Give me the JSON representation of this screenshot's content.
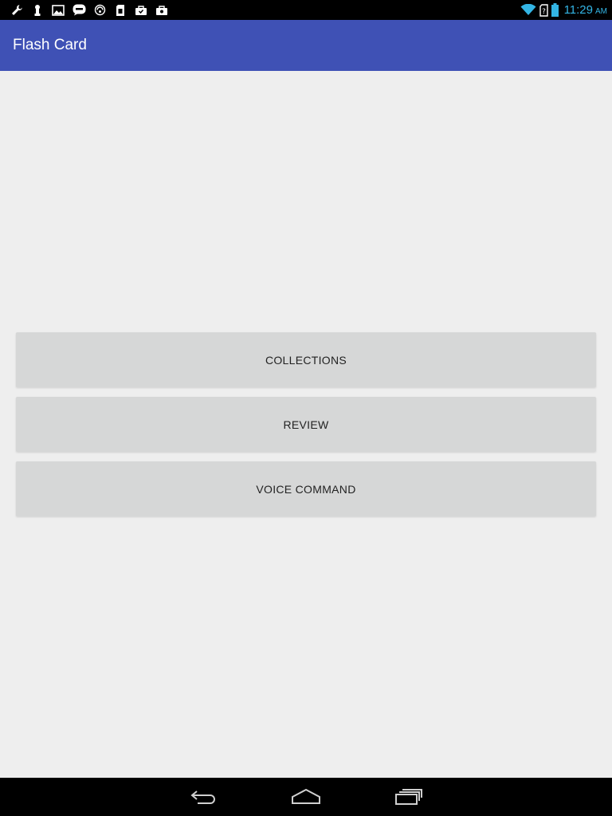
{
  "status_bar": {
    "time": "11:29",
    "ampm": "AM",
    "notification_icons": [
      "wrench-icon",
      "usb-debug-icon",
      "image-icon",
      "zalo-icon",
      "sync-icon",
      "sd-card-icon",
      "download-icon",
      "briefcase-icon"
    ],
    "system_icons": [
      "wifi-icon",
      "no-sim-icon",
      "battery-icon"
    ],
    "colors": {
      "clock": "#33b5e5",
      "icons": "#ffffff",
      "background": "#000000"
    }
  },
  "app_bar": {
    "title": "Flash Card",
    "color": "#3f51b5"
  },
  "main": {
    "buttons": [
      {
        "label": "COLLECTIONS"
      },
      {
        "label": "REVIEW"
      },
      {
        "label": "VOICE COMMAND"
      }
    ],
    "background": "#eeeeee",
    "button_color": "#d6d7d7"
  },
  "nav_bar": {
    "items": [
      "back-icon",
      "home-icon",
      "recent-apps-icon"
    ]
  }
}
